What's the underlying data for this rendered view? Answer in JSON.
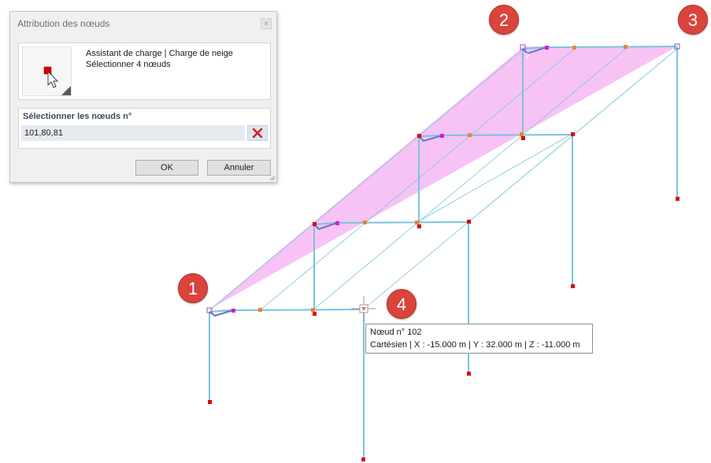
{
  "dialog": {
    "title": "Attribution des nœuds",
    "close_glyph": "×",
    "info_line1": "Assistant de charge | Charge de neige",
    "info_line2": "Sélectionner 4 nœuds",
    "icon": "node-select-cursor-icon",
    "selection_label": "Sélectionner les nœuds n°",
    "selection_value": "101,80,81",
    "clear_icon": "red-x-icon",
    "ok_label": "OK",
    "cancel_label": "Annuler"
  },
  "viewport": {
    "node_label": "2"
  },
  "callouts": [
    "1",
    "2",
    "3",
    "4"
  ],
  "tooltip": {
    "line1": "Nœud n° 102",
    "line2": "Cartésien | X : -15.000 m | Y : 32.000 m | Z : -11.000 m"
  },
  "colors": {
    "member_blue": "#78c4e0",
    "member_dark": "#6a72c8",
    "snow_pink": "#f6b8f2",
    "node_red": "#e00000",
    "node_orange": "#f08030",
    "node_magenta": "#d020d0",
    "callout_red": "#d9443c"
  }
}
